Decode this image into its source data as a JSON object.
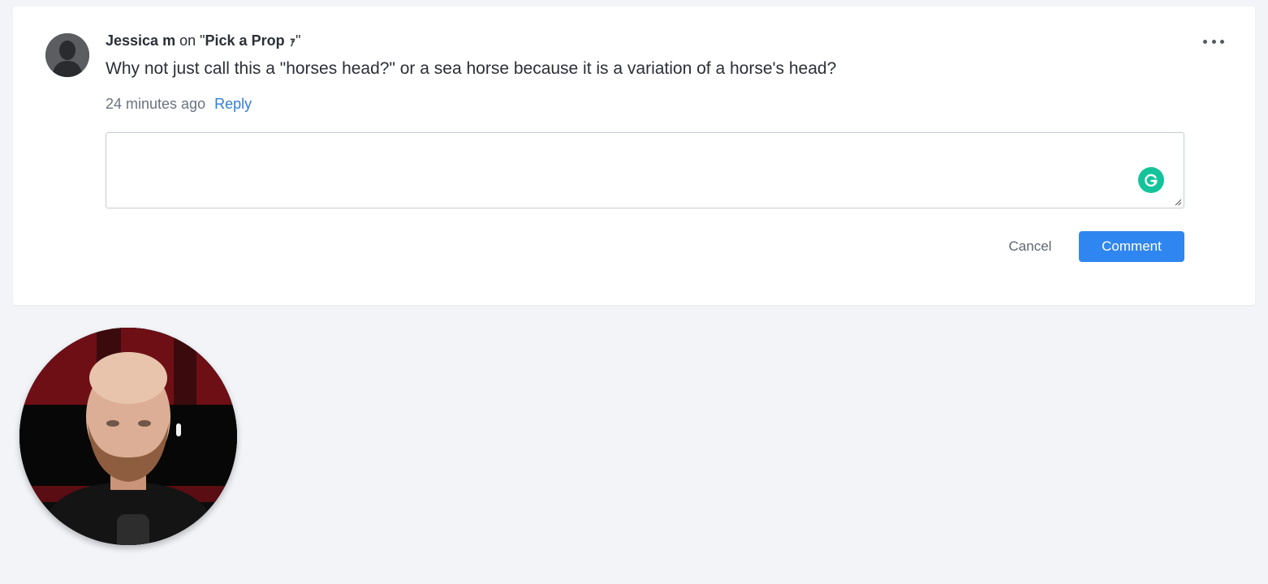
{
  "comment": {
    "author": "Jessica m",
    "on_word": "on",
    "open_quote": "\"",
    "prop_name": "Pick a Prop",
    "prop_glyph": "ｧ",
    "close_quote": "\"",
    "text": "Why not just call this a \"horses head?\" or a sea horse because it is a variation of a horse's head?",
    "timestamp": "24 minutes ago",
    "reply_label": "Reply"
  },
  "reply_form": {
    "value": "",
    "cancel_label": "Cancel",
    "submit_label": "Comment"
  },
  "icons": {
    "more": "more-options-icon",
    "grammarly": "grammarly-icon",
    "avatar": "default-user-avatar"
  },
  "colors": {
    "page_bg": "#f3f4f8",
    "card_bg": "#ffffff",
    "link": "#2f7fd8",
    "primary_button": "#2f86f0",
    "grammarly": "#15c39a"
  }
}
